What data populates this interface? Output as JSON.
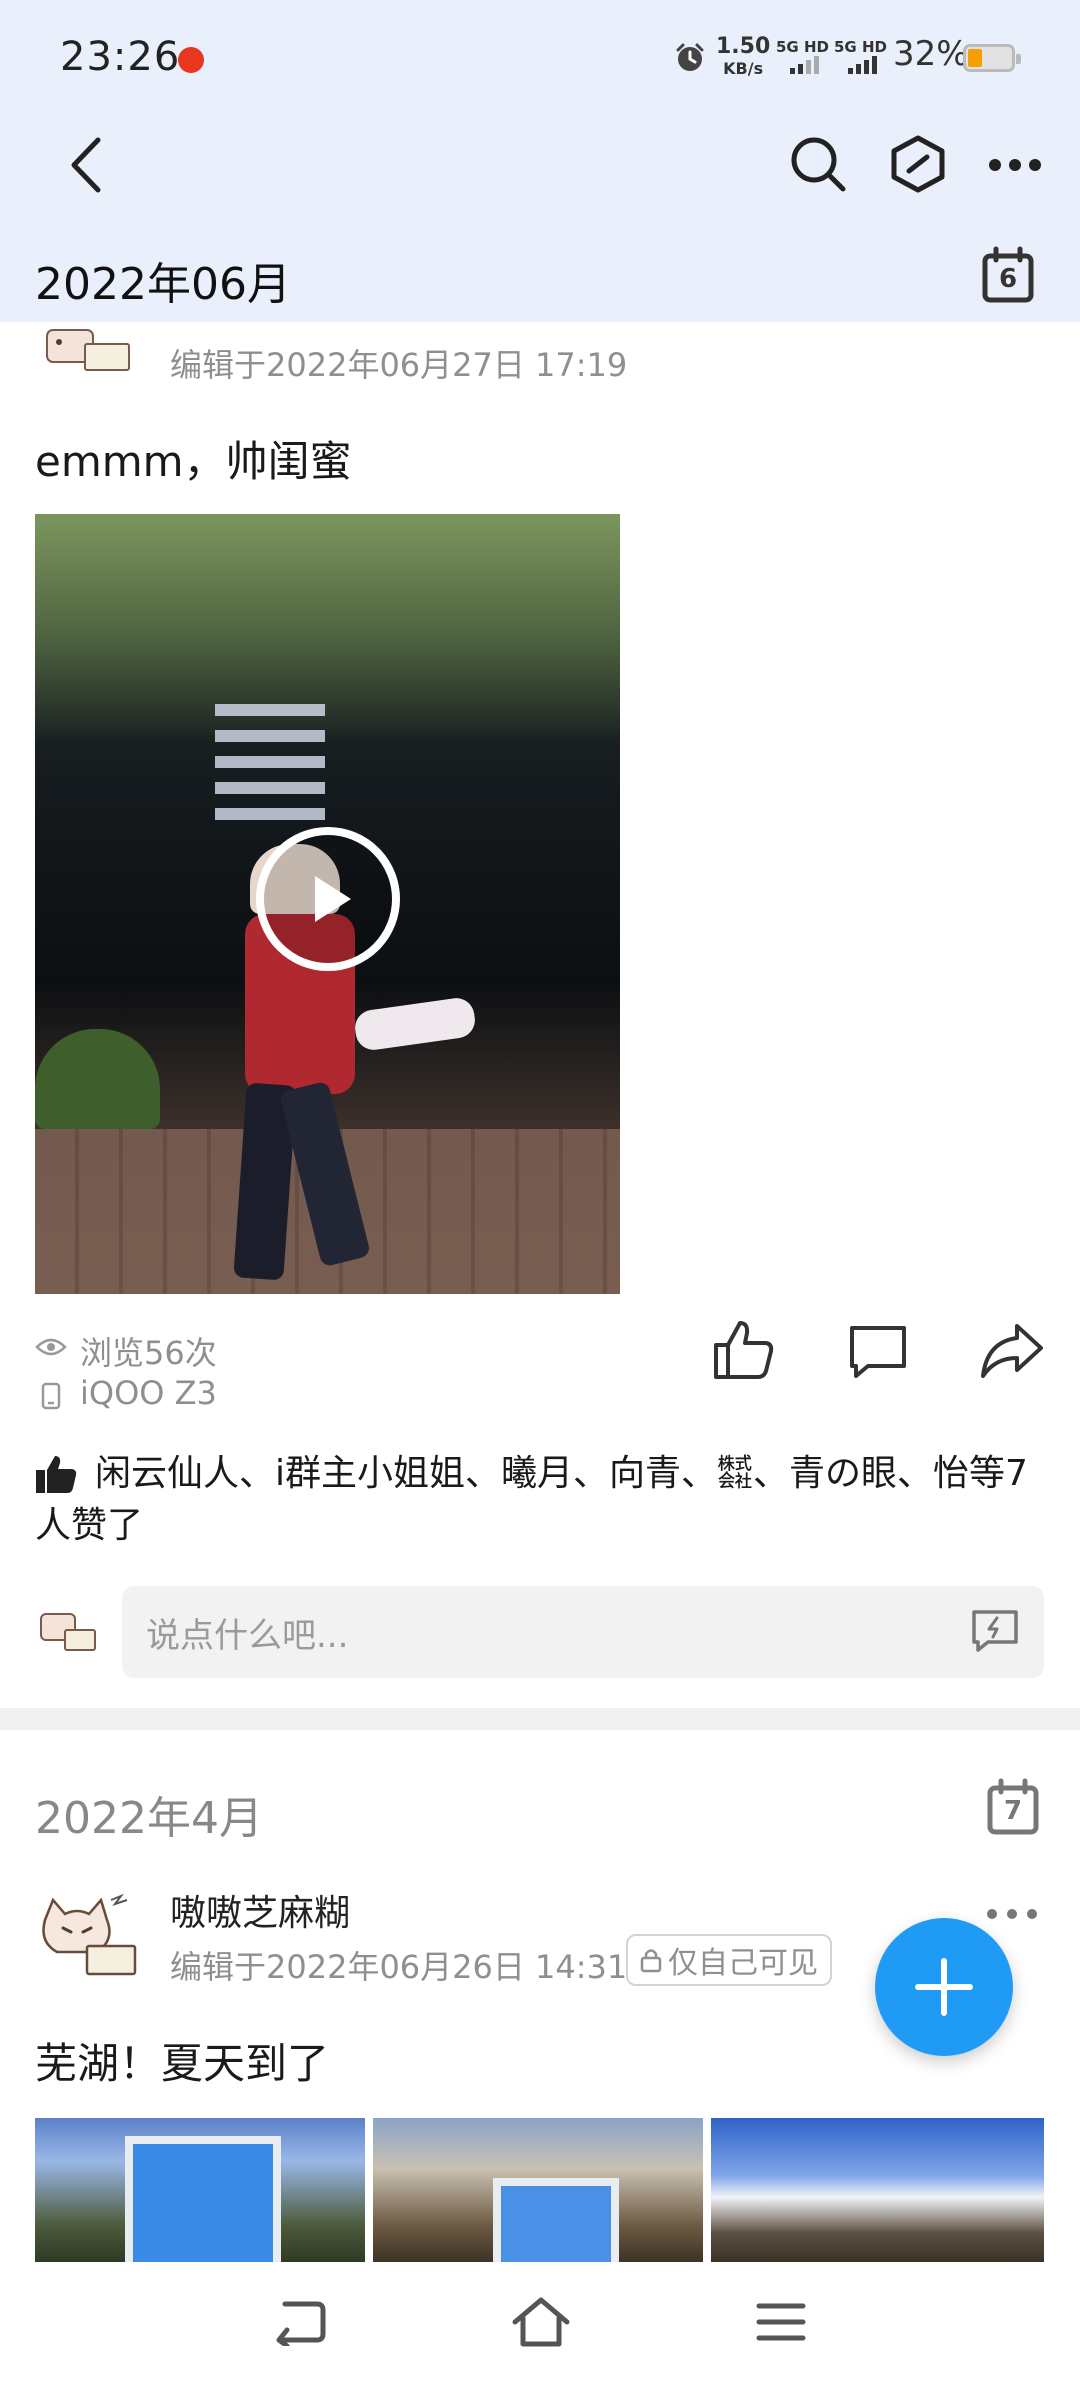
{
  "status_bar": {
    "time": "23:26",
    "net_speed_value": "1.50",
    "net_speed_unit": "KB/s",
    "sim1": "5G HD",
    "sim2": "5G HD",
    "battery": "32%"
  },
  "header": {
    "back_icon": "chevron-left-icon",
    "search_icon": "search-icon",
    "hex_icon": "hexagon-icon",
    "more_icon": "more-horizontal-icon"
  },
  "sticky_month": {
    "label": "2022年06月",
    "calendar_day": "6"
  },
  "post1": {
    "edited": "编辑于2022年06月27日 17:19",
    "text": "emmm，帅闺蜜",
    "views": "浏览56次",
    "device": "iQOO Z3",
    "likes": "闲云仙人、i群主小姐姐、曦月、向青、㍿、青の眼、怡等7人赞了",
    "comment_placeholder": "说点什么吧..."
  },
  "section2": {
    "month": "2022年4月",
    "calendar_day": "7"
  },
  "post2": {
    "author": "嗷嗷芝麻糊",
    "edited": "编辑于2022年06月26日 14:31",
    "privacy": "仅自己可见",
    "text": "芜湖！夏天到了"
  },
  "colors": {
    "accent": "#1f9bf6",
    "header_bg": "#eaf0fb",
    "battery": "#f5a000"
  }
}
